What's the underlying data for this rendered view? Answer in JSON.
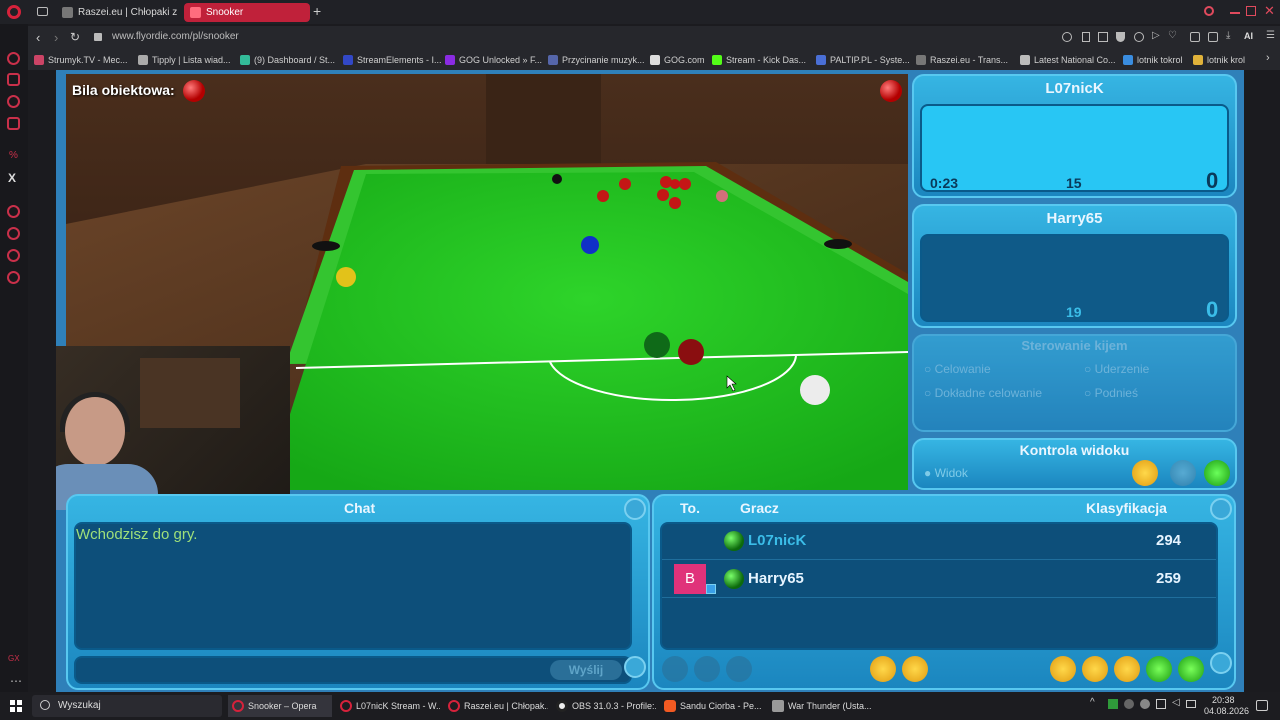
{
  "browser": {
    "tabs": [
      {
        "label": "Raszei.eu | Chłopaki z Ras",
        "active": false
      },
      {
        "label": "Snooker",
        "active": true
      }
    ],
    "url": "www.flyordie.com/pl/snooker",
    "bookmarks": [
      "Strumyk.TV - Mec...",
      "Tipply | Lista wiad...",
      "(9) Dashboard / St...",
      "StreamElements - I...",
      "GOG Unlocked » F...",
      "Przycinanie muzyk...",
      "GOG.com",
      "Stream - Kick Das...",
      "PALTIP.PL - Syste...",
      "Raszei.eu - Trans...",
      "Latest National Co...",
      "lotnik tokrol",
      "lotnik krol"
    ]
  },
  "game": {
    "object_ball_label": "Bila obiektowa:",
    "player1": {
      "name": "L07nicK",
      "timer": "0:23",
      "remaining": "15",
      "score": "0"
    },
    "player2": {
      "name": "Harry65",
      "remaining": "19",
      "score": "0"
    },
    "cue_control": {
      "title": "Sterowanie kijem",
      "options": [
        "Celowanie",
        "Uderzenie",
        "Dokładne celowanie",
        "Podnieś"
      ]
    },
    "view_control": {
      "title": "Kontrola widoku",
      "option": "Widok"
    },
    "chat": {
      "title": "Chat",
      "message": "Wchodzisz do gry.",
      "send_label": "Wyślij"
    },
    "players_table": {
      "columns": [
        "To.",
        "Gracz",
        "Klasyfikacja"
      ],
      "rows": [
        {
          "turn": "",
          "name": "L07nicK",
          "rating": "294"
        },
        {
          "turn": "B",
          "name": "Harry65",
          "rating": "259"
        }
      ]
    }
  },
  "taskbar": {
    "search_placeholder": "Wyszukaj",
    "items": [
      "Snooker – Opera",
      "L07nicK Stream - W...",
      "Raszei.eu | Chłopak...",
      "OBS 31.0.3 - Profile:...",
      "Sandu Ciorba - Pe...",
      "War Thunder (Usta..."
    ],
    "time": "20:38",
    "date": "04.08.2026"
  }
}
